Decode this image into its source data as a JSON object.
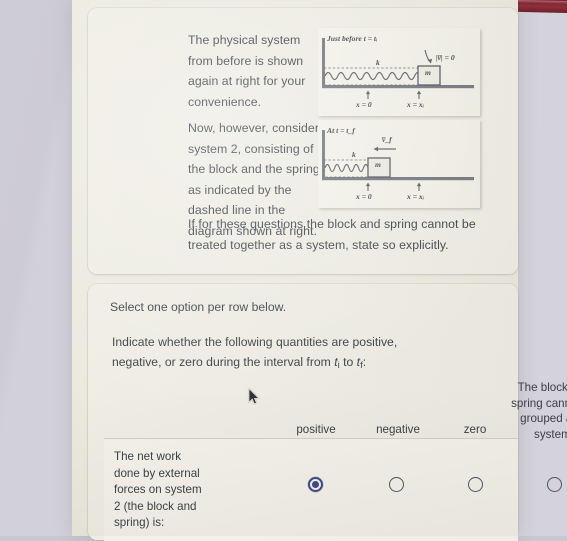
{
  "passage": {
    "para_1": "The physical system from before is shown again at right for your convenience.",
    "para_2": "Now, however, consider system 2, consisting of the block and the spring, as indicated by the dashed line in the diagram shown at right.",
    "para_3": "If for these questions the block and spring cannot be treated together as a system, state so explicitly."
  },
  "figures": [
    {
      "name": "figure-initial",
      "caption": "Just before t = tᵢ",
      "spring_label": "k",
      "block_label": "m",
      "velocity_label": "|v̅| = 0",
      "origin_label": "x = 0",
      "position_label": "x = xᵢ"
    },
    {
      "name": "figure-final",
      "caption": "At t = t_f",
      "spring_label": "k",
      "block_label": "m",
      "velocity_label": "v̅_f",
      "origin_label": "x = 0",
      "position_label": "x = xᵢ"
    }
  ],
  "question_card": {
    "select_hint": "Select one option per row below.",
    "stem_line_1": "Indicate whether the following quantities are positive,",
    "stem_line_2_pre": "negative, or zero during the interval from",
    "stem_t_i": "t",
    "stem_t_i_sub": "i",
    "stem_to": "to",
    "stem_t_f": "t",
    "stem_t_f_sub": "f",
    "stem_end": ":",
    "columns": [
      "positive",
      "negative",
      "zero",
      "The block and spring cannot be grouped as a system."
    ],
    "rows": [
      {
        "label": "The net work done by external forces on system 2 (the block and spring) is:",
        "selected_index": 0
      }
    ],
    "accent_color": "#3f4a85",
    "radio_outline_color": "#4c5360"
  },
  "device": {
    "bezel_color": "#7a2330",
    "page_background": "#ecead f",
    "backdrop_color": "#cfccd6"
  }
}
